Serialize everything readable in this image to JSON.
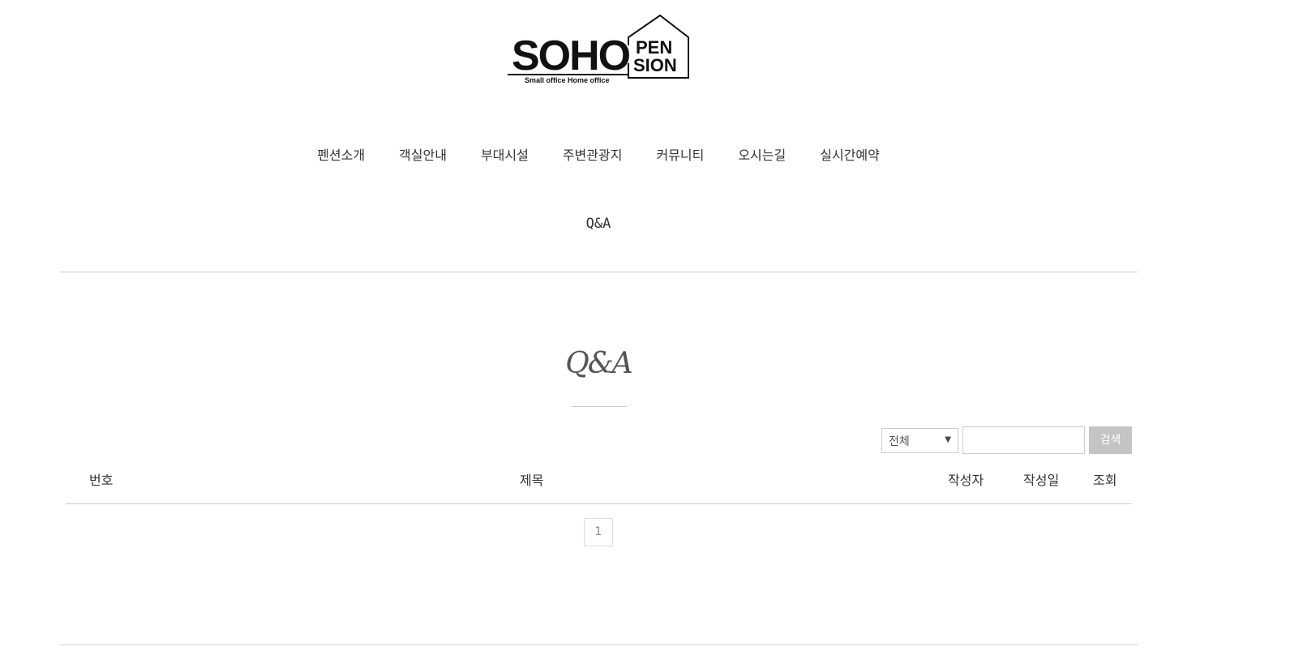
{
  "logo": {
    "main": "SOHO",
    "pen": "PEN",
    "sion": "SION",
    "tagline": "Small office Home office"
  },
  "nav": {
    "items": [
      "펜션소개",
      "객실안내",
      "부대시설",
      "주변관광지",
      "커뮤니티",
      "오시는길",
      "실시간예약"
    ],
    "qa": "Q&A"
  },
  "page": {
    "title": "Q&A"
  },
  "search": {
    "select_value": "전체",
    "input_value": "",
    "button_label": "검색",
    "button_color": "#c4c4c4"
  },
  "table": {
    "headers": {
      "no": "번호",
      "subject": "제목",
      "author": "작성자",
      "date": "작성일",
      "views": "조회"
    }
  },
  "pagination": {
    "current": "1"
  }
}
